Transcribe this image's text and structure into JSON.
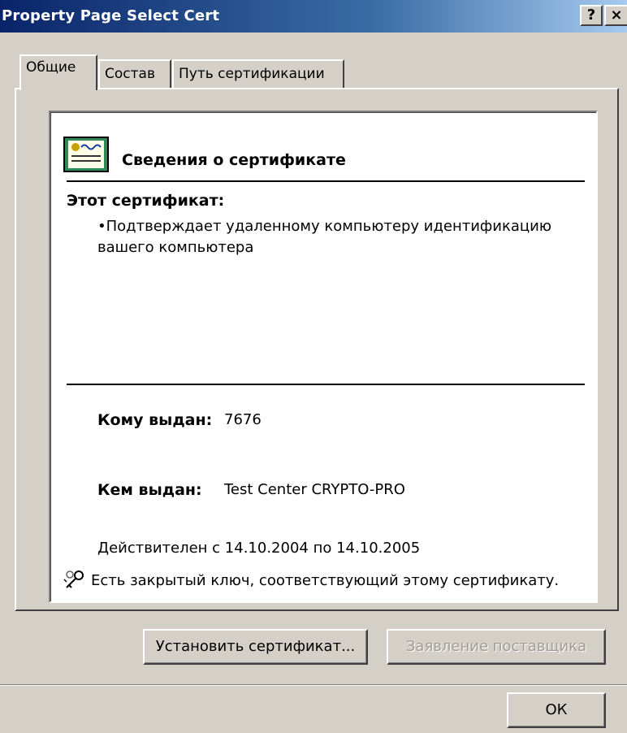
{
  "window": {
    "title": "Property Page Select Cert",
    "help_label": "?",
    "close_label": "×"
  },
  "tabs": [
    {
      "label": "Общие",
      "active": true
    },
    {
      "label": "Состав",
      "active": false
    },
    {
      "label": "Путь сертификации",
      "active": false
    }
  ],
  "info": {
    "title": "Сведения о сертификате",
    "this_cert_label": "Этот сертификат:",
    "purposes": [
      "•Подтверждает удаленному компьютеру идентификацию вашего компьютера"
    ],
    "issued_to_label": "Кому выдан:",
    "issued_to_value": "7676",
    "issued_by_label": "Кем выдан:",
    "issued_by_value": "Test Center CRYPTO-PRO",
    "validity": {
      "from_label": "Действителен с",
      "from_date": "14.10.2004",
      "to_label": "по",
      "to_date": "14.10.2005"
    },
    "private_key_note": "Есть закрытый ключ, соответствующий этому сертификату.",
    "icons": {
      "certificate": "certificate-icon",
      "key": "key-icon"
    }
  },
  "buttons": {
    "install_label": "Установить сертификат...",
    "disclaimer_label": "Заявление поставщика",
    "ok_label": "ОК"
  },
  "colors": {
    "titlebar_start": "#0a246a",
    "titlebar_end": "#a6caf0",
    "face": "#d4d0c8",
    "disabled_text": "#a09c94"
  }
}
